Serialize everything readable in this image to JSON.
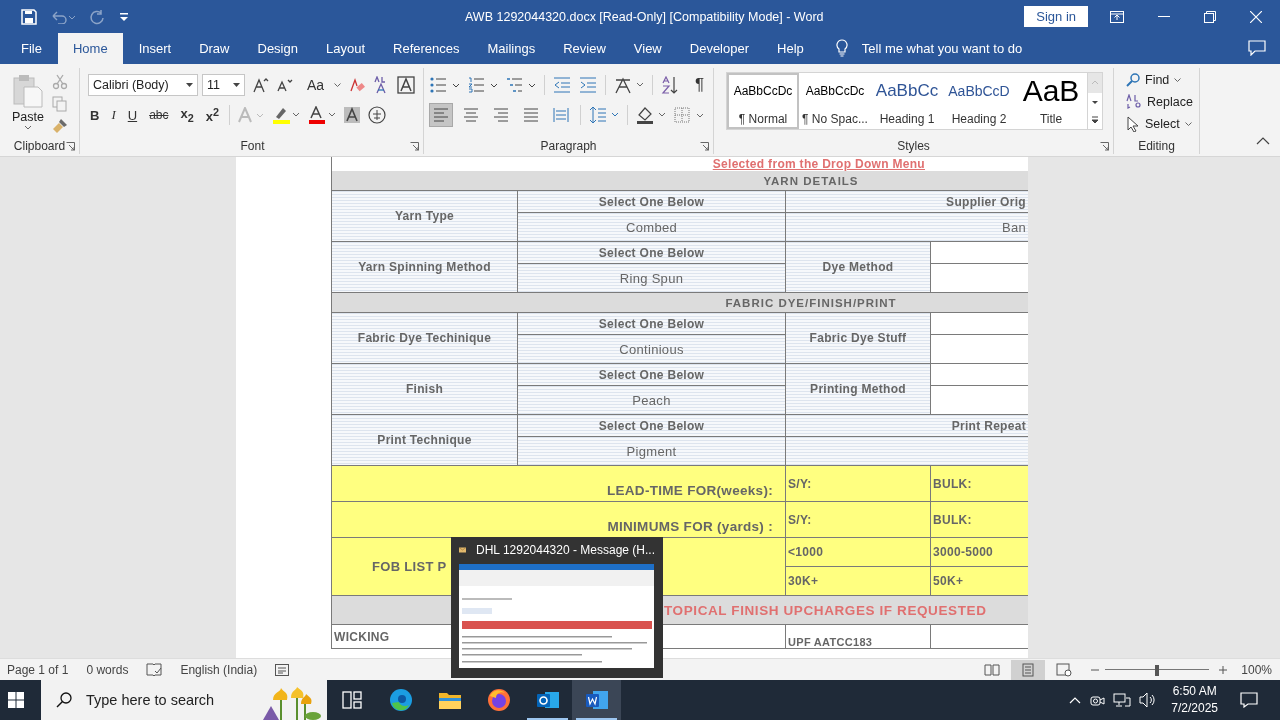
{
  "window": {
    "title": "AWB 1292044320.docx [Read-Only] [Compatibility Mode]  -  Word",
    "sign_in": "Sign in"
  },
  "ribbon_tabs": [
    {
      "label": "File",
      "selected": false
    },
    {
      "label": "Home",
      "selected": true
    },
    {
      "label": "Insert",
      "selected": false
    },
    {
      "label": "Draw",
      "selected": false
    },
    {
      "label": "Design",
      "selected": false
    },
    {
      "label": "Layout",
      "selected": false
    },
    {
      "label": "References",
      "selected": false
    },
    {
      "label": "Mailings",
      "selected": false
    },
    {
      "label": "Review",
      "selected": false
    },
    {
      "label": "View",
      "selected": false
    },
    {
      "label": "Developer",
      "selected": false
    },
    {
      "label": "Help",
      "selected": false
    }
  ],
  "tell_me": "Tell me what you want to do",
  "clipboard": {
    "paste": "Paste",
    "label": "Clipboard"
  },
  "font": {
    "family": "Calibri (Body)",
    "size": "11",
    "change_case": "Aa",
    "styles": [
      "B",
      "I",
      "U",
      "abc",
      "x$_{2}$",
      "x$^{2}$"
    ],
    "label": "Font"
  },
  "paragraph": {
    "align": [
      {
        "kind": "left",
        "selected": true
      },
      {
        "kind": "center",
        "selected": false
      },
      {
        "kind": "right",
        "selected": false
      },
      {
        "kind": "justify",
        "selected": false
      },
      {
        "kind": "distributed",
        "selected": false
      }
    ],
    "marks": "¶",
    "label": "Paragraph"
  },
  "styles": {
    "label": "Styles",
    "items": [
      {
        "kind": "normal",
        "preview": "AaBbCcDc",
        "name": "¶ Normal",
        "selected": true
      },
      {
        "kind": "normal",
        "preview": "AaBbCcDc",
        "name": "¶ No Spac...",
        "selected": false
      },
      {
        "kind": "heading1",
        "preview": "AaBbCc",
        "name": "Heading 1",
        "selected": false
      },
      {
        "kind": "heading2",
        "preview": "AaBbCcD",
        "name": "Heading 2",
        "selected": false
      },
      {
        "kind": "title",
        "preview": "AaB",
        "name": "Title",
        "selected": false
      }
    ]
  },
  "editing": {
    "label": "Editing",
    "items": [
      {
        "kind": "find",
        "label": "Find"
      },
      {
        "kind": "replace",
        "label": "Replace"
      },
      {
        "kind": "select",
        "label": "Select"
      }
    ]
  },
  "document": {
    "note": "Selected from the Drop Down Menu",
    "sections": [
      {
        "title": "YARN DETAILS",
        "rows": [
          {
            "kind": "supplier",
            "label": "Yarn Type",
            "prompt": "Select One Below",
            "value": "Combed",
            "side_label": "Supplier Orig",
            "side_value": "Ban"
          },
          {
            "kind": "labeled",
            "label": "Yarn Spinning Method",
            "prompt": "Select One Below",
            "value": "Ring Spun",
            "side_label": "Dye Method"
          }
        ]
      },
      {
        "title": "FABRIC DYE/FINISH/PRINT",
        "rows": [
          {
            "kind": "labeled",
            "label": "Fabric Dye Techinique",
            "prompt": "Select One Below",
            "value": "Continious",
            "side_label": "Fabric Dye Stuff"
          },
          {
            "kind": "labeled",
            "label": "Finish",
            "prompt": "Select One Below",
            "value": "Peach",
            "side_label": "Printing Method"
          },
          {
            "kind": "repeat",
            "label": "Print Technique",
            "prompt": "Select One Below",
            "value": "Pigment",
            "side_label": "Print Repeat"
          }
        ]
      }
    ],
    "terms": [
      {
        "label": "LEAD-TIME FOR(weeks):",
        "sample": "S/Y:",
        "bulk": "BULK:"
      },
      {
        "label": "MINIMUMS FOR (yards) :",
        "sample": "S/Y:",
        "bulk": "BULK:"
      }
    ],
    "price": {
      "label": "FOB LIST P",
      "tiers": [
        [
          "<1000",
          "3000-5000"
        ],
        [
          "30K+",
          "50K+"
        ]
      ]
    },
    "upcharges": {
      "title": "TOPICAL FINISH UPCHARGES IF REQUESTED",
      "rows": [
        {
          "name": "WICKING",
          "test": "UPF AATCC183"
        }
      ]
    }
  },
  "preview": {
    "title": "DHL 1292044320 - Message (H..."
  },
  "status_bar": {
    "page": "Page 1 of 1",
    "words": "0 words",
    "language": "English (India)",
    "views": [
      {
        "kind": "read",
        "selected": false
      },
      {
        "kind": "print",
        "selected": true
      },
      {
        "kind": "web",
        "selected": false
      }
    ],
    "zoom": {
      "level": 0.5,
      "reading": "100%"
    }
  },
  "taskbar": {
    "search_placeholder": "Type here to search",
    "apps": [
      {
        "kind": "taskview",
        "running": false,
        "active": false
      },
      {
        "kind": "edge",
        "running": false,
        "active": false
      },
      {
        "kind": "explorer",
        "running": false,
        "active": false
      },
      {
        "kind": "firefox",
        "running": false,
        "active": false
      },
      {
        "kind": "outlook",
        "running": true,
        "active": false
      },
      {
        "kind": "word",
        "running": true,
        "active": true
      }
    ],
    "time": "6:50 AM",
    "date": "7/2/2025"
  }
}
